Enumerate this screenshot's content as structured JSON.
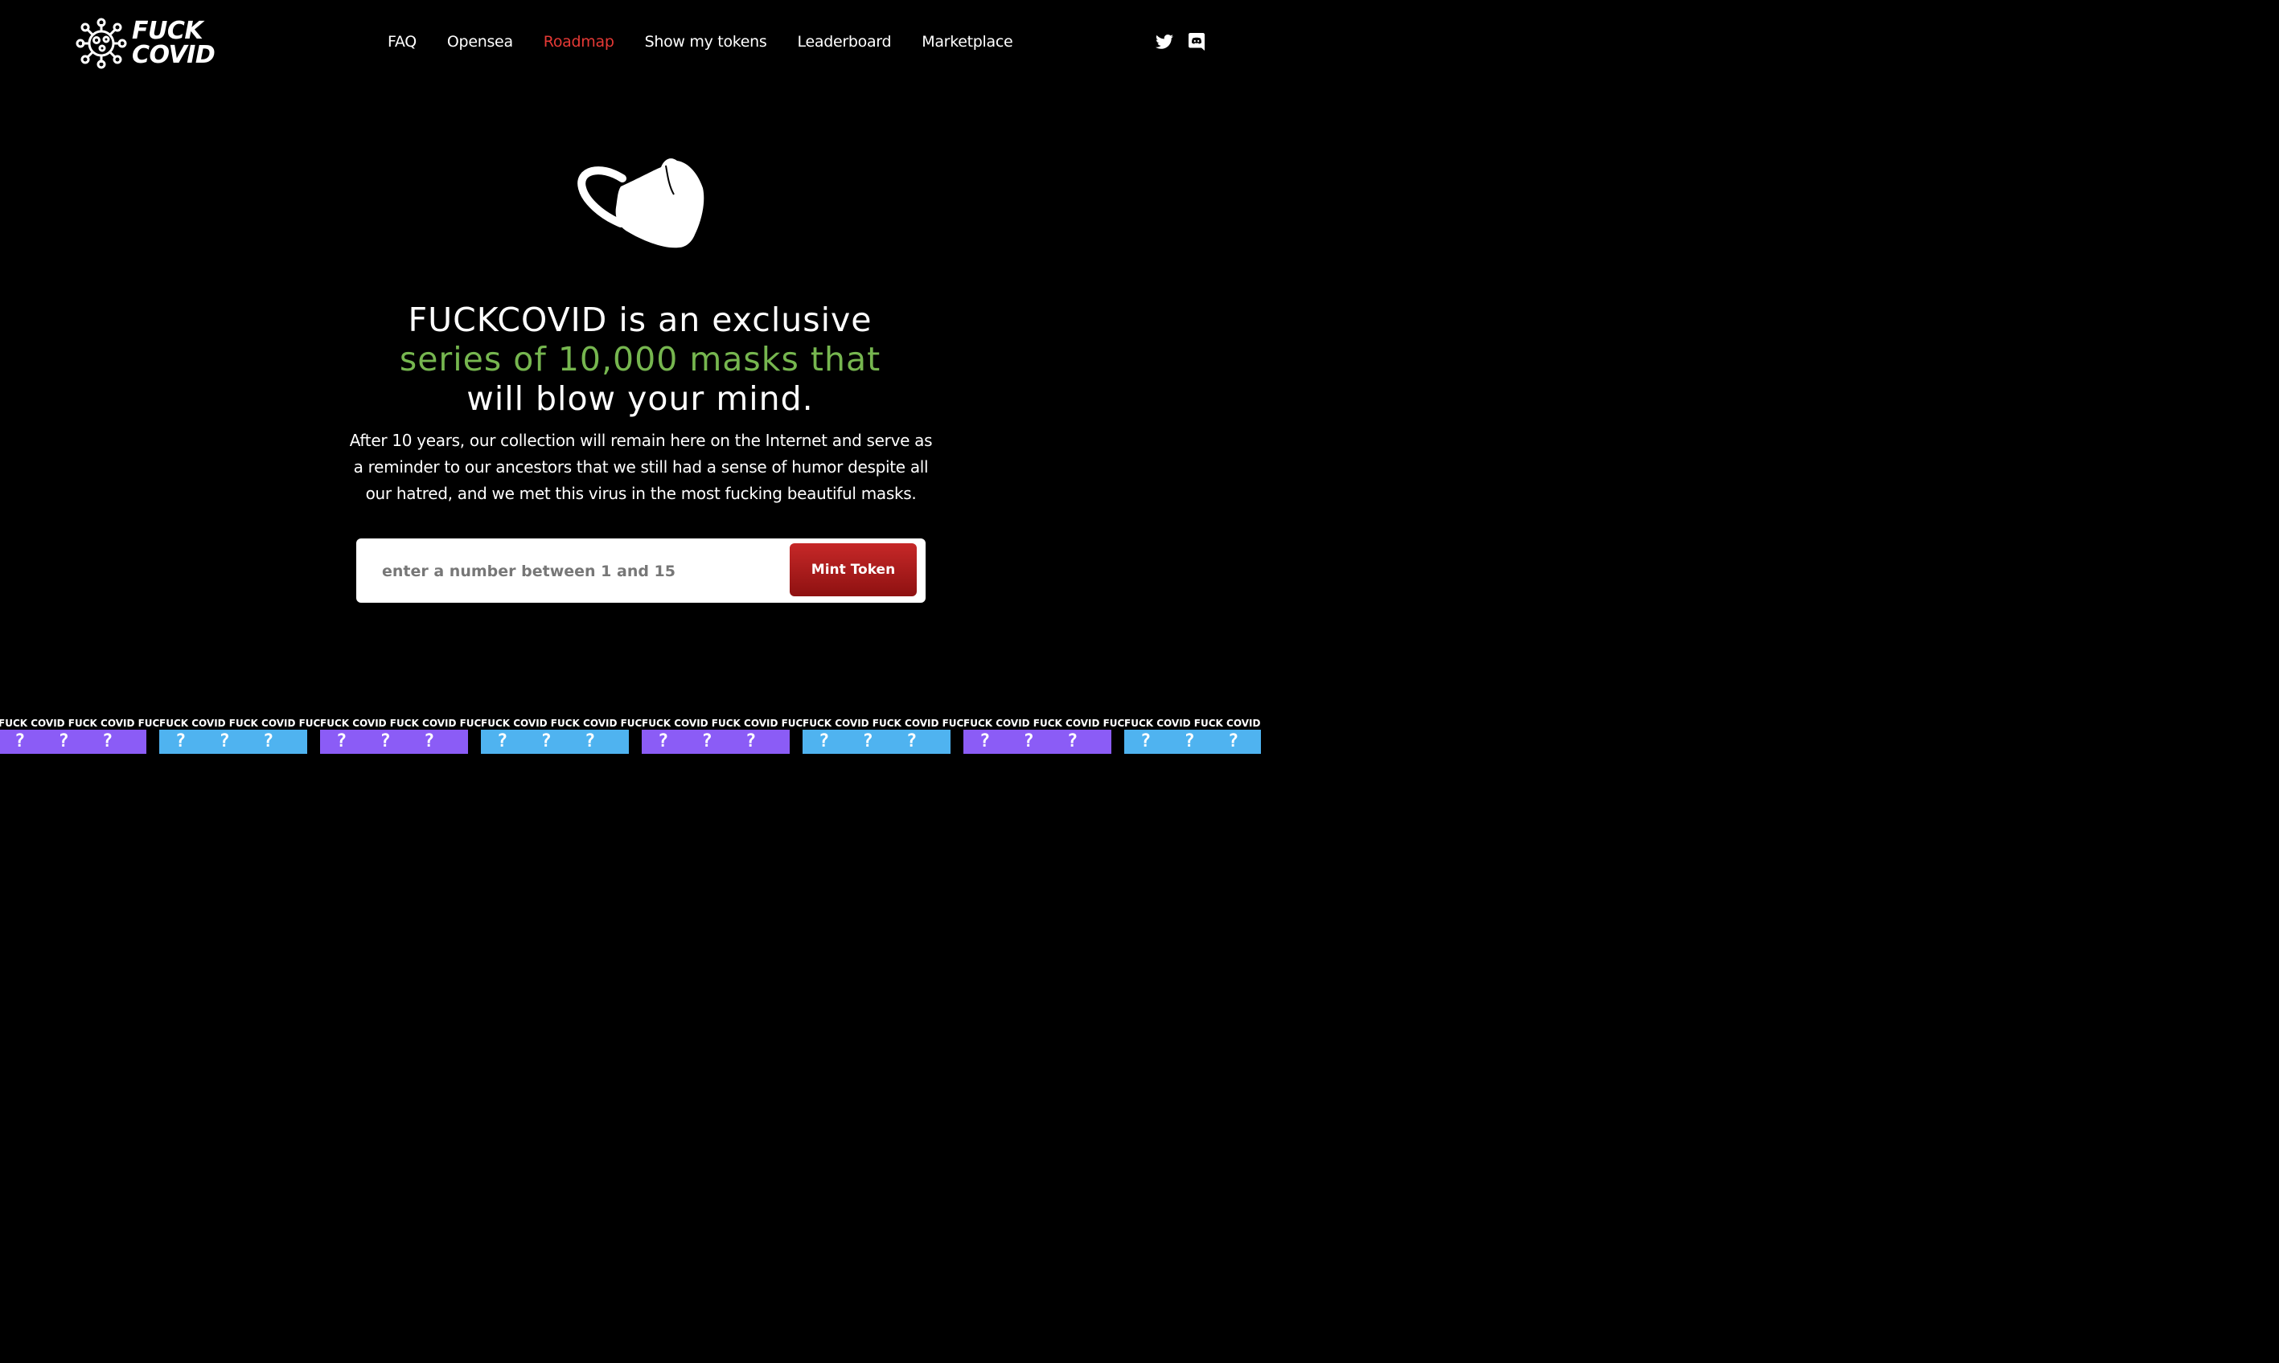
{
  "header": {
    "logo": {
      "line1": "FUCK",
      "line2": "COVID"
    },
    "nav": [
      {
        "label": "FAQ",
        "active": false
      },
      {
        "label": "Opensea",
        "active": false
      },
      {
        "label": "Roadmap",
        "active": true
      },
      {
        "label": "Show my tokens",
        "active": false
      },
      {
        "label": "Leaderboard",
        "active": false
      },
      {
        "label": "Marketplace",
        "active": false
      }
    ],
    "socials": [
      {
        "icon": "twitter-icon"
      },
      {
        "icon": "discord-icon"
      }
    ]
  },
  "hero": {
    "illustration_icon": "face-mask-icon",
    "headline_line1": "FUCKCOVID is an exclusive",
    "headline_line2": "series of 10,000 masks that",
    "headline_line3": "will blow your mind.",
    "subcopy": "After 10 years, our collection will remain here on the Internet and serve as a reminder to our ancestors that we still had a sense of humor despite all our hatred, and we met this virus in the most fucking beautiful masks."
  },
  "mint": {
    "input_value": "",
    "input_placeholder": "enter a number between 1 and 15",
    "button_label": "Mint Token"
  },
  "strip": {
    "banner_text": "FUCK COVID FUCK COVID FUCK COVID FUCK COVID",
    "tile_glyphs": "? ? ? ?",
    "tile_colors": [
      "#8b5cf6",
      "#4fb3f0"
    ]
  },
  "colors": {
    "background": "#000000",
    "accent_red": "#e53935",
    "headline_green": "#76b64f",
    "button_red": "#c62828"
  }
}
